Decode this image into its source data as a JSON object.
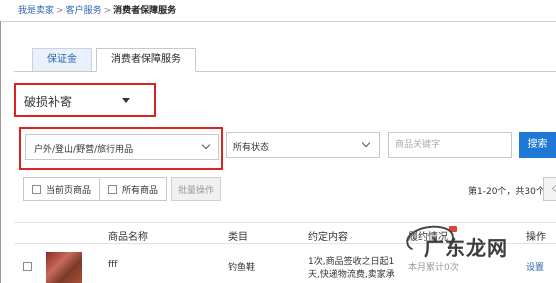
{
  "breadcrumb": {
    "item1": "我是卖家",
    "item2": "客户服务",
    "current": "消费者保障服务",
    "separator": ">"
  },
  "tabs": [
    {
      "label": "保证金"
    },
    {
      "label": "消费者保障服务"
    }
  ],
  "filters": {
    "service_type": "破损补寄",
    "category": "户外/登山/野营/旅行用品",
    "status": "所有状态",
    "keyword_placeholder": "商品关键字",
    "search_label": "搜索"
  },
  "batch": {
    "current_page": "当前页商品",
    "all": "所有商品",
    "action": "批量操作"
  },
  "pagination": {
    "text": "第1-20个，共30个"
  },
  "table": {
    "headers": {
      "name": "商品名称",
      "category": "类目",
      "agreement": "约定内容",
      "performance": "履约情况",
      "action": "操作"
    },
    "rows": [
      {
        "name": "fff",
        "category": "钓鱼鞋",
        "agreement_line1": "1次,商品签收之日起1",
        "agreement_line2": "天,快递物流费,卖家承",
        "performance": "本月累计0次",
        "action": "设置"
      }
    ]
  },
  "watermark": {
    "text": "广东龙网"
  },
  "colors": {
    "link": "#2d64b3",
    "highlight_border": "#d9251c",
    "primary_button": "#1f77d6"
  }
}
